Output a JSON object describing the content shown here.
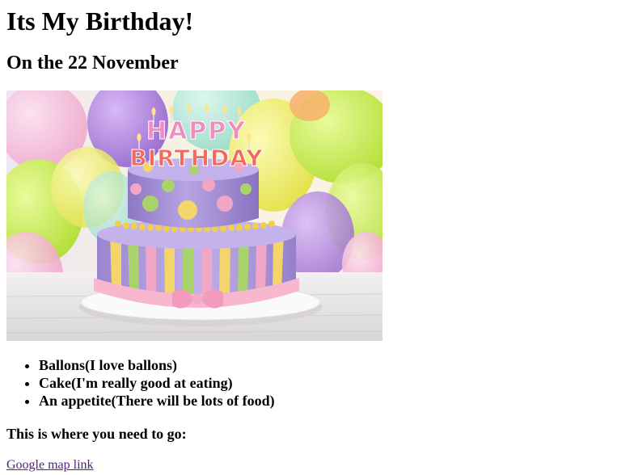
{
  "header": {
    "title": "Its My Birthday!",
    "date_line": "On the 22 November"
  },
  "photo": {
    "topper_line1": "HAPPY",
    "topper_line2": "BIRTHDAY",
    "colors": {
      "balloon_purple": "#b98be0",
      "balloon_green": "#c7ec4f",
      "balloon_yellow": "#f2f06b",
      "balloon_pink": "#f5b3d6",
      "cake_lilac": "#a993d8",
      "ribbon_pink": "#f7b8cf",
      "stripe_yellow": "#f4d56a",
      "stripe_green": "#a9d36b",
      "stripe_pink": "#f0a6c4"
    }
  },
  "list": {
    "items": [
      "Ballons(I love ballons)",
      "Cake(I'm really good at eating)",
      "An appetite(There will be lots of food)"
    ]
  },
  "directions": {
    "label": "This is where you need to go:",
    "link_text": "Google map link"
  }
}
